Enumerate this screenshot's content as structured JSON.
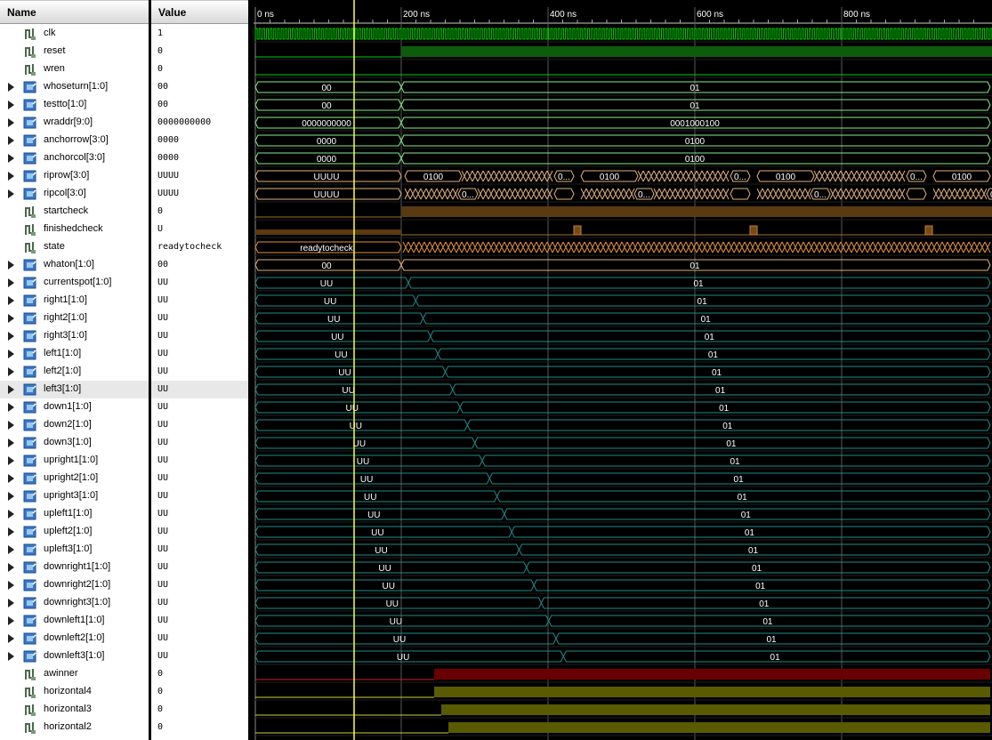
{
  "headers": {
    "name": "Name",
    "value": "Value"
  },
  "ruler": [
    "0 ns",
    "200 ns",
    "400 ns",
    "600 ns",
    "800 ns"
  ],
  "colors": {
    "clock": "#00d000",
    "high": "#0c5c0c",
    "bus": "#e0b080",
    "bus_teal": "#1e8c8c",
    "state": "#e09040",
    "yellow_fill": "#5a5a00",
    "red_fill": "#6a0000",
    "cursor": "#ffff33"
  },
  "signals": [
    {
      "name": "clk",
      "value": "1",
      "icon": "bit-icon"
    },
    {
      "name": "reset",
      "value": "0",
      "icon": "bit-icon"
    },
    {
      "name": "wren",
      "value": "0",
      "icon": "bit-icon"
    },
    {
      "name": "whoseturn[1:0]",
      "value": "00",
      "icon": "bus-icon",
      "a": "00",
      "b": "01"
    },
    {
      "name": "testto[1:0]",
      "value": "00",
      "icon": "bus-icon",
      "a": "00",
      "b": "01"
    },
    {
      "name": "wraddr[9:0]",
      "value": "0000000000",
      "icon": "bus-icon",
      "a": "0000000000",
      "b": "0001000100"
    },
    {
      "name": "anchorrow[3:0]",
      "value": "0000",
      "icon": "bus-icon",
      "a": "0000",
      "b": "0100"
    },
    {
      "name": "anchorcol[3:0]",
      "value": "0000",
      "icon": "bus-icon",
      "a": "0000",
      "b": "0100"
    },
    {
      "name": "riprow[3:0]",
      "value": "UUUU",
      "icon": "bus-icon",
      "a": "UUUU",
      "b": "0100",
      "c": "0..."
    },
    {
      "name": "ripcol[3:0]",
      "value": "UUUU",
      "icon": "bus-icon",
      "a": "UUUU",
      "c": "0..."
    },
    {
      "name": "startcheck",
      "value": "0",
      "icon": "bit-icon"
    },
    {
      "name": "finishedcheck",
      "value": "U",
      "icon": "bit-icon"
    },
    {
      "name": "state",
      "value": "readytocheck",
      "icon": "bit-icon",
      "a": "readytocheck"
    },
    {
      "name": "whaton[1:0]",
      "value": "00",
      "icon": "bus-icon",
      "a": "00",
      "b": "01"
    },
    {
      "name": "currentspot[1:0]",
      "value": "UU",
      "icon": "bus-icon",
      "a": "UU",
      "b": "01"
    },
    {
      "name": "right1[1:0]",
      "value": "UU",
      "icon": "bus-icon",
      "a": "UU",
      "b": "01"
    },
    {
      "name": "right2[1:0]",
      "value": "UU",
      "icon": "bus-icon",
      "a": "UU",
      "b": "01"
    },
    {
      "name": "right3[1:0]",
      "value": "UU",
      "icon": "bus-icon",
      "a": "UU",
      "b": "01"
    },
    {
      "name": "left1[1:0]",
      "value": "UU",
      "icon": "bus-icon",
      "a": "UU",
      "b": "01"
    },
    {
      "name": "left2[1:0]",
      "value": "UU",
      "icon": "bus-icon",
      "a": "UU",
      "b": "01"
    },
    {
      "name": "left3[1:0]",
      "value": "UU",
      "icon": "bus-icon",
      "a": "UU",
      "b": "01",
      "selected": true
    },
    {
      "name": "down1[1:0]",
      "value": "UU",
      "icon": "bus-icon",
      "a": "UU",
      "b": "01"
    },
    {
      "name": "down2[1:0]",
      "value": "UU",
      "icon": "bus-icon",
      "a": "UU",
      "b": "01"
    },
    {
      "name": "down3[1:0]",
      "value": "UU",
      "icon": "bus-icon",
      "a": "UU",
      "b": "01"
    },
    {
      "name": "upright1[1:0]",
      "value": "UU",
      "icon": "bus-icon",
      "a": "UU",
      "b": "01"
    },
    {
      "name": "upright2[1:0]",
      "value": "UU",
      "icon": "bus-icon",
      "a": "UU",
      "b": "01"
    },
    {
      "name": "upright3[1:0]",
      "value": "UU",
      "icon": "bus-icon",
      "a": "UU",
      "b": "01"
    },
    {
      "name": "upleft1[1:0]",
      "value": "UU",
      "icon": "bus-icon",
      "a": "UU",
      "b": "01"
    },
    {
      "name": "upleft2[1:0]",
      "value": "UU",
      "icon": "bus-icon",
      "a": "UU",
      "b": "01"
    },
    {
      "name": "upleft3[1:0]",
      "value": "UU",
      "icon": "bus-icon",
      "a": "UU",
      "b": "01"
    },
    {
      "name": "downright1[1:0]",
      "value": "UU",
      "icon": "bus-icon",
      "a": "UU",
      "b": "01"
    },
    {
      "name": "downright2[1:0]",
      "value": "UU",
      "icon": "bus-icon",
      "a": "UU",
      "b": "01"
    },
    {
      "name": "downright3[1:0]",
      "value": "UU",
      "icon": "bus-icon",
      "a": "UU",
      "b": "01"
    },
    {
      "name": "downleft1[1:0]",
      "value": "UU",
      "icon": "bus-icon",
      "a": "UU",
      "b": "01"
    },
    {
      "name": "downleft2[1:0]",
      "value": "UU",
      "icon": "bus-icon",
      "a": "UU",
      "b": "01"
    },
    {
      "name": "downleft3[1:0]",
      "value": "UU",
      "icon": "bus-icon",
      "a": "UU",
      "b": "01"
    },
    {
      "name": "awinner",
      "value": "0",
      "icon": "bit-icon"
    },
    {
      "name": "horizontal4",
      "value": "0",
      "icon": "bit-icon"
    },
    {
      "name": "horizontal3",
      "value": "0",
      "icon": "bit-icon"
    },
    {
      "name": "horizontal2",
      "value": "0",
      "icon": "bit-icon"
    }
  ]
}
